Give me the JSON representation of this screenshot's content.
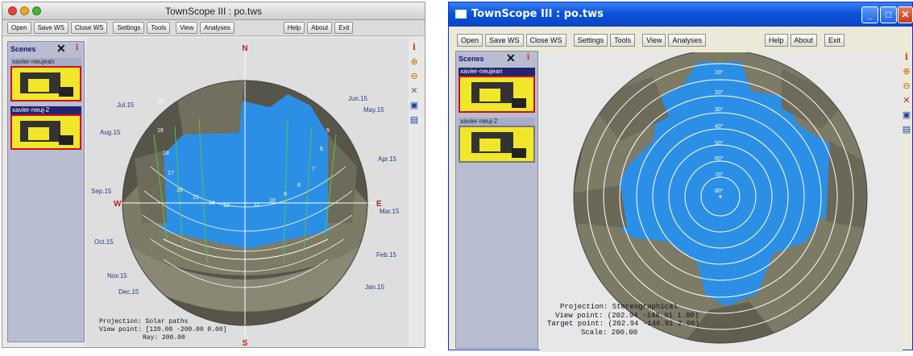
{
  "left_window": {
    "title": "TownScope III : po.tws",
    "toolbar": [
      "Open",
      "Save WS",
      "Close WS",
      "Settings",
      "Tools",
      "View",
      "Analyses",
      "Help",
      "About",
      "Exit"
    ],
    "scenes_label": "Scenes",
    "scenes": [
      {
        "name": "xavier-neujean",
        "selected": false
      },
      {
        "name": "xavier-neuj-2",
        "selected": true
      }
    ],
    "compass": {
      "north": "N",
      "south": "S",
      "east": "E",
      "west": "W"
    },
    "date_labels_left": [
      "Jul.15",
      "Aug.15",
      "Sep.15",
      "Oct.15",
      "Nov.15",
      "Dec.15"
    ],
    "date_labels_right": [
      "Jun.15",
      "May.15",
      "Apr.15",
      "Mar.15",
      "Feb.15",
      "Jan.15"
    ],
    "hour_labels": [
      "20",
      "19",
      "18",
      "17",
      "16",
      "15",
      "14",
      "13",
      "11",
      "10",
      "9",
      "8",
      "7",
      "6",
      "5"
    ],
    "info": {
      "projection": "Projection: Solar paths",
      "view_point": "View point: [120.00 -200.00 0.00]",
      "ray": "Ray: 200.00"
    }
  },
  "right_window": {
    "title": "TownScope III : po.tws",
    "toolbar": [
      "Open",
      "Save WS",
      "Close WS",
      "Settings",
      "Tools",
      "View",
      "Analyses",
      "Help",
      "About",
      "Exit"
    ],
    "scenes_label": "Scenes",
    "scenes": [
      {
        "name": "xavier-neujean",
        "selected": true
      },
      {
        "name": "xavier-neuj-2",
        "selected": false
      }
    ],
    "altitude_labels": [
      "10°",
      "20°",
      "30°",
      "40°",
      "50°",
      "60°",
      "70°",
      "80°"
    ],
    "info": {
      "projection": "Projection: Stereographical",
      "view_point": "View point: (202.94 -148.91 1.00)",
      "target_point": "Target point: (202.94 -148.91 2.00)",
      "scale": "Scale: 200.00"
    }
  },
  "colors": {
    "sky": "#2b8fe6",
    "buildings": "#7d7a66",
    "disc_ground": "#57554a",
    "sidebar": "#b9bdd2",
    "xp_title": "#0a52d8",
    "thumbnail": "#f0e62a"
  }
}
